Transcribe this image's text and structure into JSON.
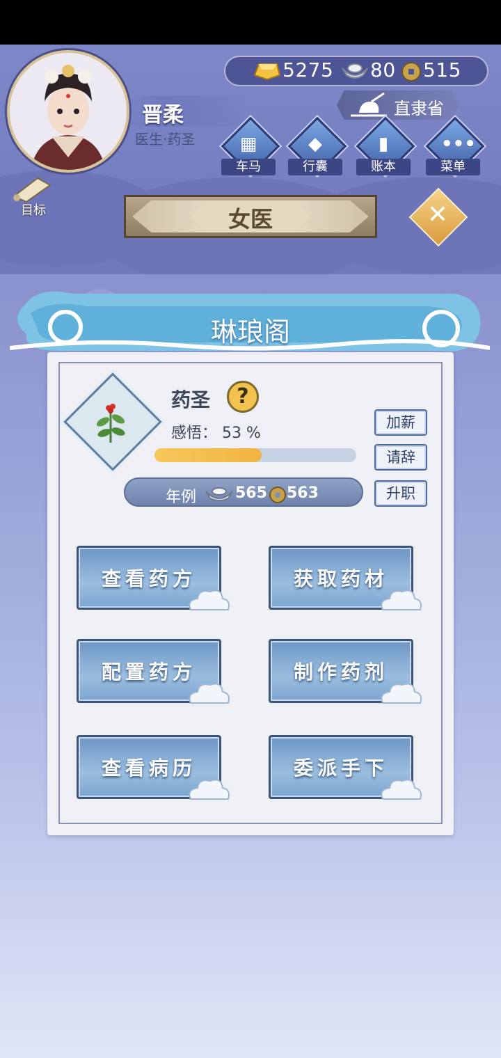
{
  "player": {
    "name": "晋柔",
    "title": "医生·药圣"
  },
  "currency": {
    "gold": "5275",
    "silver": "80",
    "coins": "515"
  },
  "location": "直隶省",
  "nav": [
    {
      "label": "车马",
      "icon": "carriage-icon"
    },
    {
      "label": "行囊",
      "icon": "bag-icon"
    },
    {
      "label": "账本",
      "icon": "ledger-icon"
    },
    {
      "label": "菜单",
      "icon": "menu-dots-icon"
    }
  ],
  "goal_label": "目标",
  "page_title": "女医",
  "venue": "琳琅阁",
  "job": {
    "rank": "药圣",
    "insight_text": "感悟： 53 %",
    "insight_percent": 53,
    "salary_label": "年例",
    "salary_silver": "565",
    "salary_coins": "563"
  },
  "side_buttons": {
    "raise": "加薪",
    "resign": "请辞",
    "promote": "升职"
  },
  "actions": [
    "查看药方",
    "获取药材",
    "配置药方",
    "制作药剂",
    "查看病历",
    "委派手下"
  ],
  "colors": {
    "accent_gold": "#f2c14e",
    "progress_fill": "#f0b441",
    "panel_bg": "#eef0f6",
    "button_blue": "#6e97c6"
  }
}
